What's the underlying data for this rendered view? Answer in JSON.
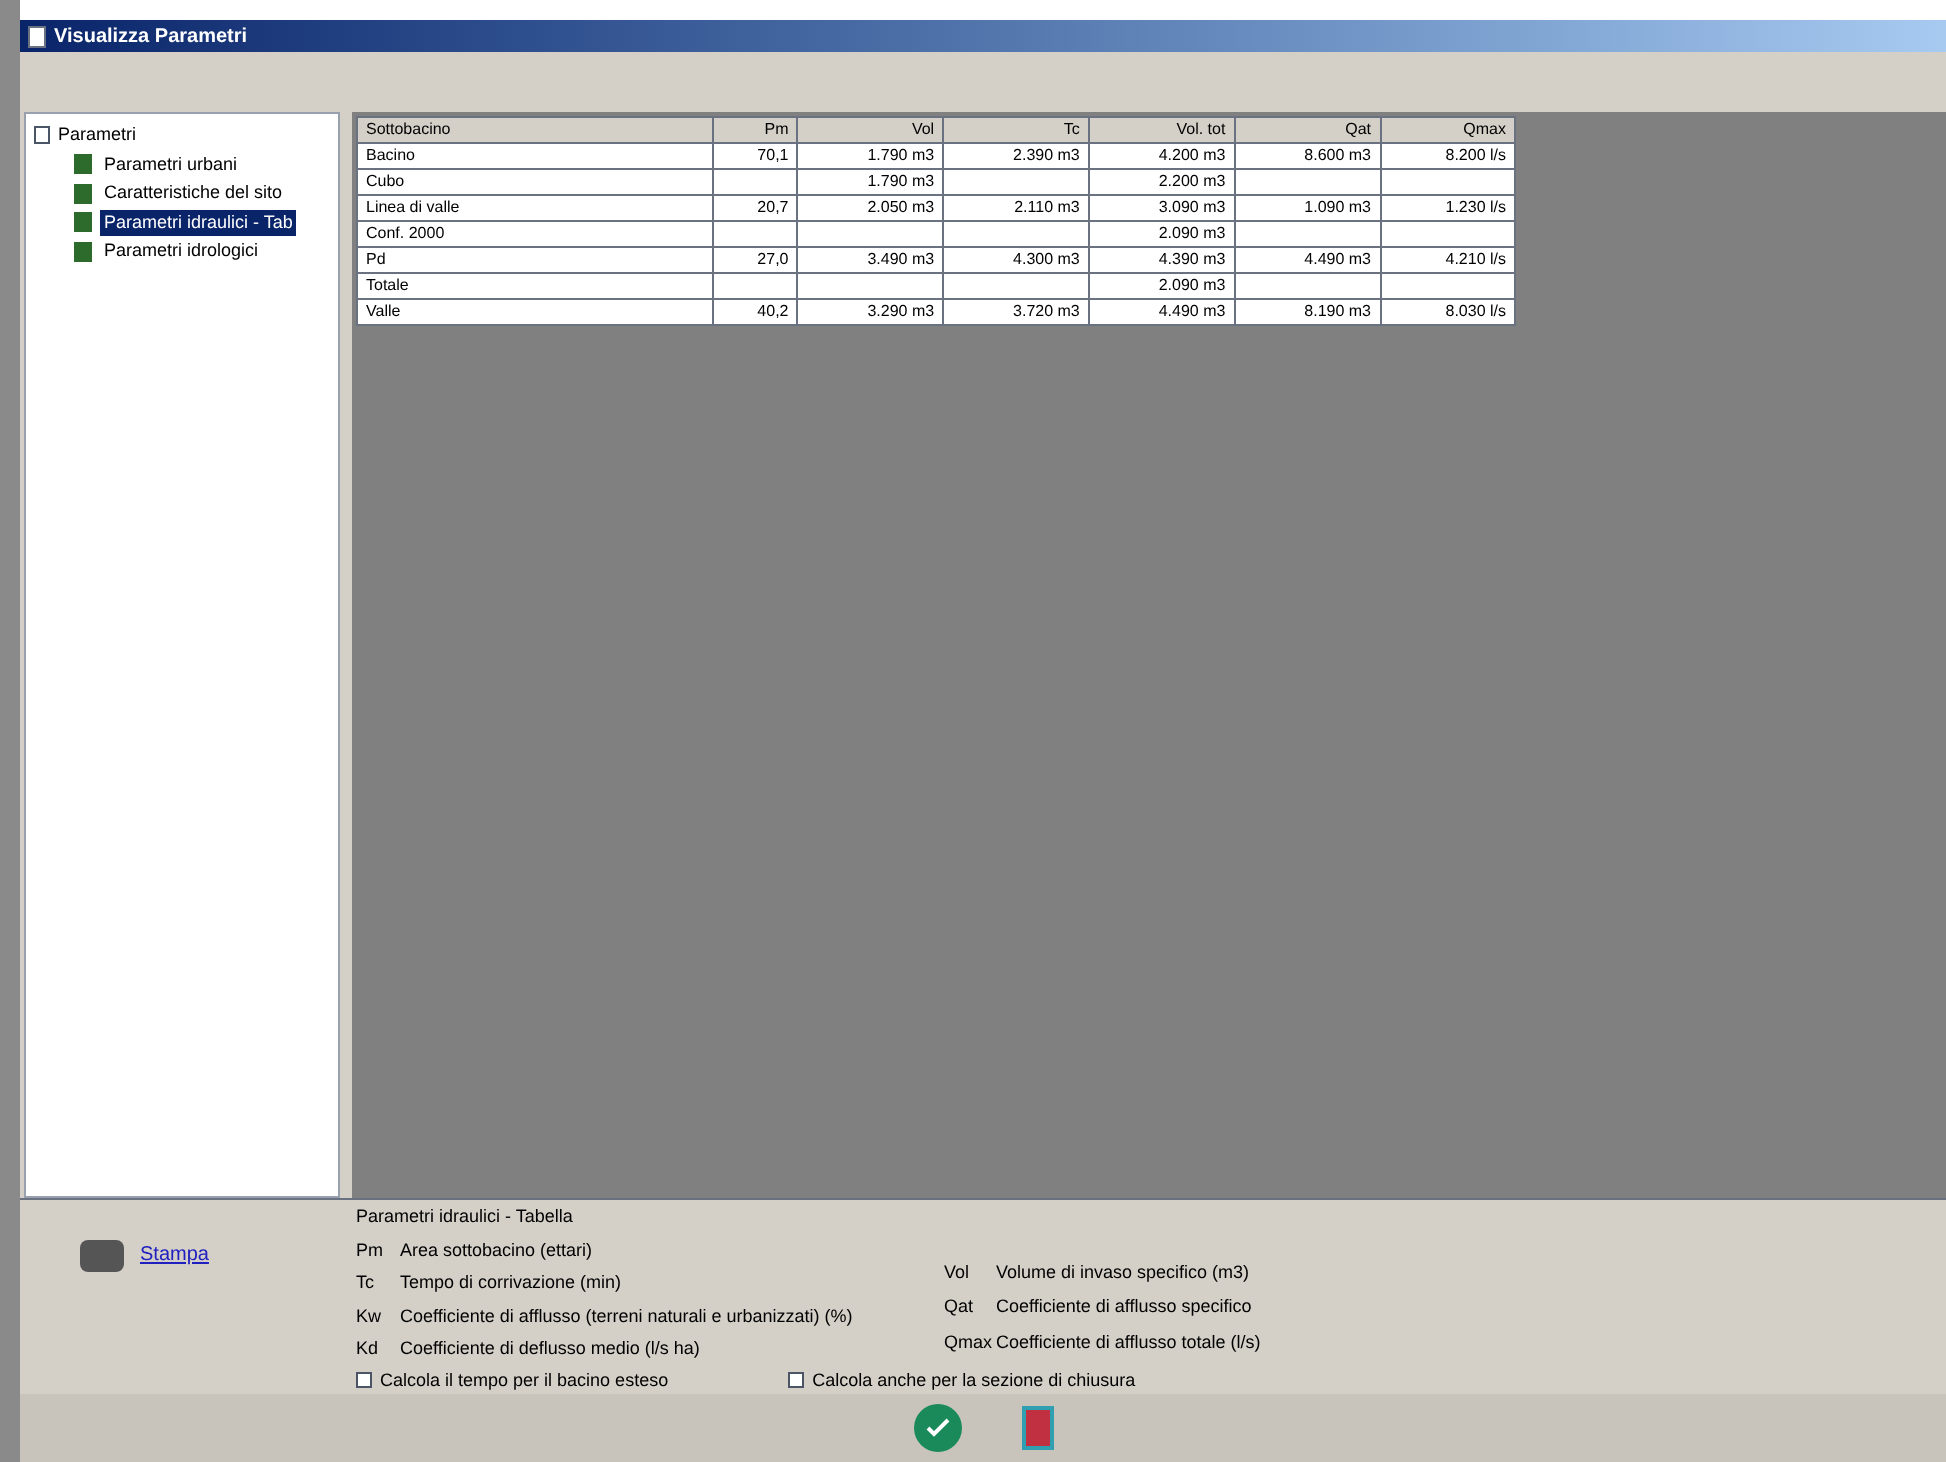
{
  "window": {
    "title": "Visualizza Parametri"
  },
  "tree": {
    "label": "Parametri",
    "children": [
      {
        "label": "Parametri urbani",
        "selected": false
      },
      {
        "label": "Caratteristiche del sito",
        "selected": false
      },
      {
        "label": "Parametri idraulici - Tab",
        "selected": true
      },
      {
        "label": "Parametri idrologici",
        "selected": false
      }
    ]
  },
  "print_link": "Stampa",
  "table": {
    "columns": [
      "Sottobacino",
      "Pm",
      "Vol",
      "Tc",
      "Vol. tot",
      "Qat",
      "Qmax"
    ],
    "rows": [
      [
        "Bacino",
        "70,1",
        "1.790 m3",
        "2.390 m3",
        "4.200 m3",
        "8.600 m3",
        "8.200 l/s"
      ],
      [
        "Cubo",
        "",
        "1.790 m3",
        "",
        "2.200 m3",
        "",
        ""
      ],
      [
        "Linea di valle",
        "20,7",
        "2.050 m3",
        "2.110 m3",
        "3.090 m3",
        "1.090 m3",
        "1.230 l/s"
      ],
      [
        "Conf. 2000",
        "",
        "",
        "",
        "2.090 m3",
        "",
        ""
      ],
      [
        "Pd",
        "27,0",
        "3.490 m3",
        "4.300 m3",
        "4.390 m3",
        "4.490 m3",
        "4.210 l/s"
      ],
      [
        "Totale",
        "",
        "",
        "",
        "2.090 m3",
        "",
        ""
      ],
      [
        "Valle",
        "40,2",
        "3.290 m3",
        "3.720 m3",
        "4.490 m3",
        "8.190 m3",
        "8.030 l/s"
      ]
    ]
  },
  "legend": {
    "title": "Parametri idraulici - Tabella",
    "left": [
      {
        "abbr": "Pm",
        "text": "Area sottobacino (ettari)"
      },
      {
        "abbr": "Tc",
        "text": "Tempo di corrivazione (min)"
      },
      {
        "abbr": "Kw",
        "text": "Coefficiente di afflusso (terreni naturali e urbanizzati) (%)"
      },
      {
        "abbr": "Kd",
        "text": "Coefficiente di deflusso medio (l/s ha)"
      }
    ],
    "right": [
      {
        "abbr": "Vol",
        "text": "Volume di invaso specifico (m3)"
      },
      {
        "abbr": "Qat",
        "text": "Coefficiente di afflusso specifico"
      },
      {
        "abbr": "Qmax",
        "text": "Coefficiente di afflusso totale (l/s)"
      }
    ],
    "checks": [
      {
        "label": "Calcola il tempo per il bacino esteso",
        "checked": false
      },
      {
        "label": "Calcola anche per la sezione di chiusura",
        "checked": false
      }
    ]
  }
}
